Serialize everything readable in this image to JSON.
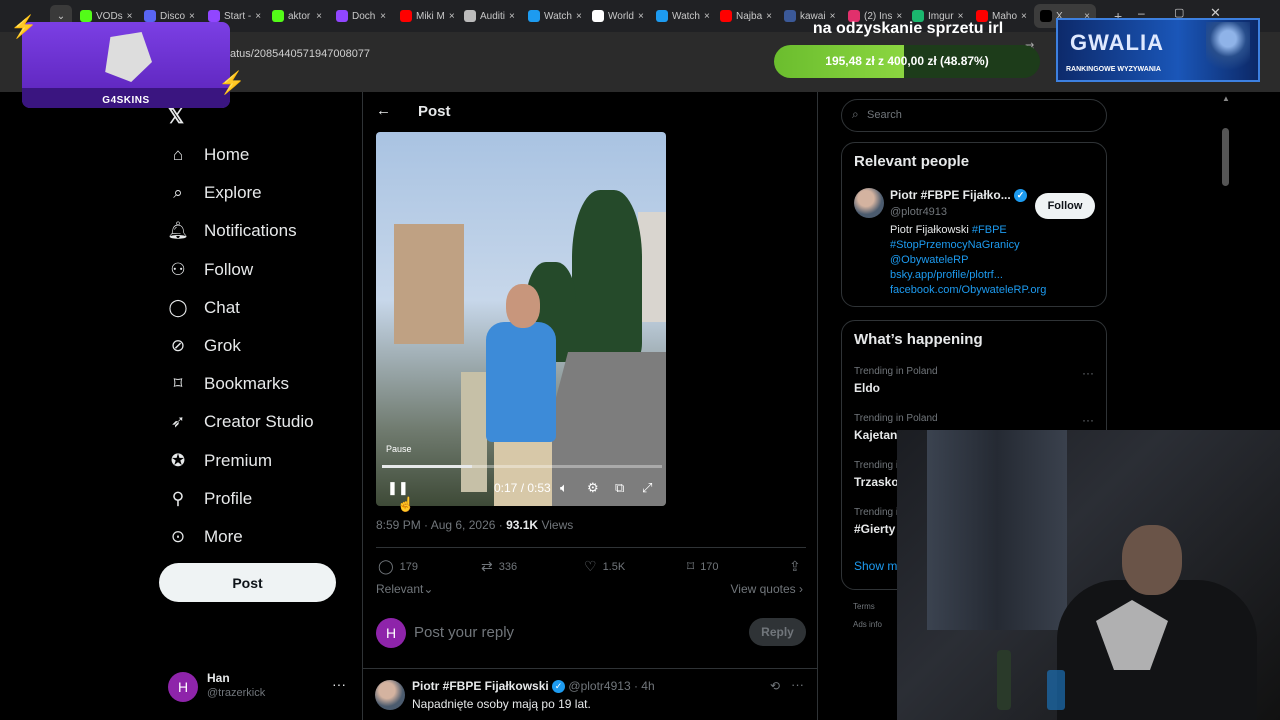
{
  "browser": {
    "tabs": [
      {
        "label": "VODs",
        "color": "#53fc18"
      },
      {
        "label": "Disco",
        "color": "#5865f2"
      },
      {
        "label": "Start -",
        "color": "#9146ff"
      },
      {
        "label": "aktor",
        "color": "#53fc18"
      },
      {
        "label": "Doch",
        "color": "#9146ff"
      },
      {
        "label": "Miki M",
        "color": "#ff0000"
      },
      {
        "label": "Auditi",
        "color": "#bbbbbb"
      },
      {
        "label": "Watch",
        "color": "#1d9bf0"
      },
      {
        "label": "World",
        "color": "#ffffff"
      },
      {
        "label": "Watch",
        "color": "#1d9bf0"
      },
      {
        "label": "Najba",
        "color": "#ff0000"
      },
      {
        "label": "kawai",
        "color": "#3b5998"
      },
      {
        "label": "(2) Ins",
        "color": "#e1306c"
      },
      {
        "label": "Imgur",
        "color": "#1bb76e"
      },
      {
        "label": "Maho",
        "color": "#ff0000"
      },
      {
        "label": "X",
        "color": "#000000"
      }
    ],
    "url": "913/status/2085440571947008077"
  },
  "overlay": {
    "g4skins_label": "G4SKINS",
    "goal_title": "na odzyskanie sprzetu irl",
    "goal_text": "195,48 zł z 400,00 zł (48.87%)",
    "goal_fraction": 0.4887,
    "gwalia_title": "GWALIA",
    "gwalia_subtitle": "RANKINGOWE WYZYWANIA"
  },
  "nav": {
    "items": [
      {
        "label": "Home",
        "icon": "home-icon"
      },
      {
        "label": "Explore",
        "icon": "search-icon"
      },
      {
        "label": "Notifications",
        "icon": "bell-icon"
      },
      {
        "label": "Follow",
        "icon": "add-person-icon"
      },
      {
        "label": "Chat",
        "icon": "chat-icon"
      },
      {
        "label": "Grok",
        "icon": "grok-icon"
      },
      {
        "label": "Bookmarks",
        "icon": "bookmark-icon"
      },
      {
        "label": "Creator Studio",
        "icon": "rocket-icon"
      },
      {
        "label": "Premium",
        "icon": "verified-icon"
      },
      {
        "label": "Profile",
        "icon": "person-icon"
      },
      {
        "label": "More",
        "icon": "more-circle-icon"
      }
    ],
    "post_label": "Post",
    "account": {
      "initial": "H",
      "name": "Han",
      "handle": "@trazerkick"
    }
  },
  "post": {
    "header": "Post",
    "video": {
      "tooltip": "Pause",
      "time": "0:17 / 0:53",
      "progress": 0.32
    },
    "timestamp": "8:59 PM · Aug 6, 2026 · ",
    "views_count": "93.1K",
    "views_label": " Views",
    "stats": {
      "replies": "179",
      "reposts": "336",
      "likes": "1.5K",
      "bookmarks": "170"
    },
    "sort": "Relevant",
    "view_quotes": "View quotes",
    "reply_placeholder": "Post your reply",
    "reply_button": "Reply",
    "reply_initial": "H"
  },
  "reply": {
    "name": "Piotr #FBPE Fijałkowski",
    "handle": "@plotr4913 · 4h",
    "text": "Napadnięte osoby mają po 19 lat."
  },
  "sidebar": {
    "search_placeholder": "Search",
    "relevant_title": "Relevant people",
    "person": {
      "name": "Piotr #FBPE Fijałko...",
      "handle": "@plotr4913",
      "follow": "Follow",
      "bio_name": "Piotr Fijałkowski ",
      "bio_tag1": "#FBPE",
      "bio_tag2": "#StopPrzemocyNaGranicy",
      "bio_mention": "@ObywateleRP",
      "bio_link1": "bsky.app/profile/plotrf...",
      "bio_link2": "facebook.com/ObywateleRP.org"
    },
    "happening_title": "What’s happening",
    "trends": [
      {
        "meta": "Trending in Poland",
        "name": "Eldo"
      },
      {
        "meta": "Trending in Poland",
        "name": "Kajetan"
      },
      {
        "meta": "Trending in",
        "name": "Trzaskow"
      },
      {
        "meta": "Trending in",
        "name": "#Gierty"
      }
    ],
    "show_more": "Show m",
    "footer1": "Terms",
    "footer2": "Ads info"
  }
}
